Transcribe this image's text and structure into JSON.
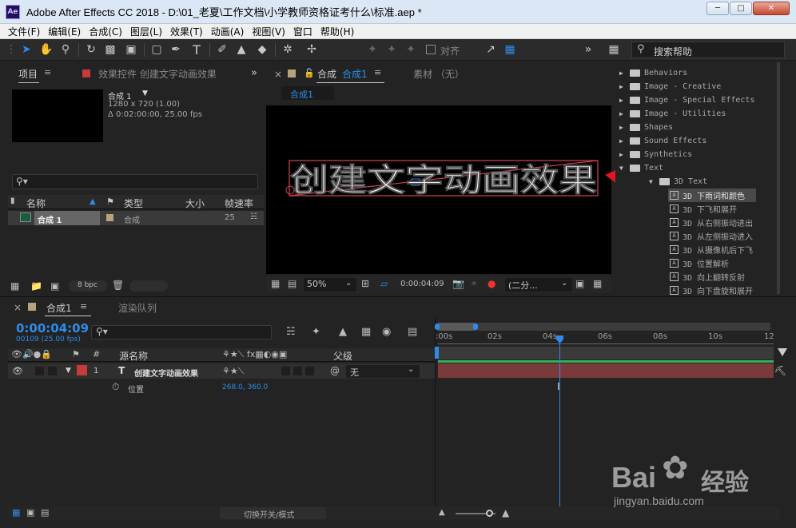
{
  "window": {
    "title": "Adobe After Effects CC 2018 - D:\\01_老夏\\工作文档\\小学教师资格证考什么\\标准.aep *",
    "app_icon": "Ae",
    "controls": [
      "minimize",
      "maximize",
      "close"
    ]
  },
  "menu": [
    "文件(F)",
    "编辑(E)",
    "合成(C)",
    "图层(L)",
    "效果(T)",
    "动画(A)",
    "视图(V)",
    "窗口",
    "帮助(H)"
  ],
  "toolbar": {
    "align_label": "对齐",
    "search_help": "搜索帮助",
    "icons": [
      "selection-tool",
      "hand-tool",
      "zoom-tool",
      "rotate-tool",
      "camera-tool",
      "pan-behind-tool",
      "rectangle-tool",
      "pen-tool",
      "type-tool",
      "brush-tool",
      "clone-stamp-tool",
      "eraser-tool",
      "roto-brush-tool",
      "puppet-pin-tool"
    ]
  },
  "project_panel": {
    "tab_label": "项目",
    "effects_tab_label": "效果控件 创建文字动画效果",
    "item_name": "合成 1",
    "item_res": "1280 x 720 (1.00)",
    "item_duration": "Δ 0:02:00:00, 25.00 fps",
    "columns": [
      "名称",
      "类型",
      "大小",
      "帧速率"
    ],
    "rows": [
      {
        "name": "合成 1",
        "type": "合成",
        "size": "",
        "fps": "25"
      }
    ],
    "bpc": "8 bpc"
  },
  "comp_panel": {
    "tab_prefix": "合成",
    "tab_name": "合成1",
    "footage_tab": "素材 （无）",
    "breadcrumb": "合成1",
    "text_content": "创建文字动画效果",
    "zoom": "50%",
    "timecode": "0:00:04:09",
    "resolution": "(二分..."
  },
  "effects_panel": {
    "items": [
      {
        "label": "Behaviors",
        "kind": "folder",
        "expanded": false
      },
      {
        "label": "Image - Creative",
        "kind": "folder",
        "expanded": false
      },
      {
        "label": "Image - Special Effects",
        "kind": "folder",
        "expanded": false
      },
      {
        "label": "Image - Utilities",
        "kind": "folder",
        "expanded": false
      },
      {
        "label": "Shapes",
        "kind": "folder",
        "expanded": false
      },
      {
        "label": "Sound Effects",
        "kind": "folder",
        "expanded": false
      },
      {
        "label": "Synthetics",
        "kind": "folder",
        "expanded": false
      },
      {
        "label": "Text",
        "kind": "folder",
        "expanded": true
      },
      {
        "label": "3D Text",
        "kind": "folder",
        "expanded": true
      },
      {
        "label": "3D 下雨词和颜色",
        "kind": "preset",
        "selected": true
      },
      {
        "label": "3D 下飞和展开",
        "kind": "preset"
      },
      {
        "label": "3D 从右侧振动进出",
        "kind": "preset"
      },
      {
        "label": "3D 从左侧振动进入",
        "kind": "preset"
      },
      {
        "label": "3D 从摄像机后下飞",
        "kind": "preset"
      },
      {
        "label": "3D 位置解析",
        "kind": "preset"
      },
      {
        "label": "3D 向上翻转反射",
        "kind": "preset"
      },
      {
        "label": "3D 向下盘旋和展开",
        "kind": "preset"
      }
    ]
  },
  "timeline": {
    "tab_label": "合成1",
    "render_queue_label": "渲染队列",
    "current_time": "0:00:04:09",
    "current_frame": "00109 (25.00 fps)",
    "columns": {
      "num": "#",
      "source": "源名称",
      "parent": "父级"
    },
    "layer": {
      "index": "1",
      "type_icon": "T",
      "name": "创建文字动画效果",
      "parent": "无"
    },
    "property": {
      "name": "位置",
      "value": "268.0, 360.0"
    },
    "ruler_labels": [
      ":00s",
      "02s",
      "04s",
      "06s",
      "08s",
      "10s",
      "12"
    ],
    "playhead_seconds": 4.36,
    "switch_mode_label": "切换开关/模式"
  },
  "watermark": {
    "brand": "Bai",
    "brand2": "经验",
    "url": "jingyan.baidu.com"
  },
  "colors": {
    "accent": "#2d8ceb",
    "layer_label": "#c73a3a",
    "layer_bar": "#7a3a3a",
    "text_stroke": "#c43d4d"
  }
}
